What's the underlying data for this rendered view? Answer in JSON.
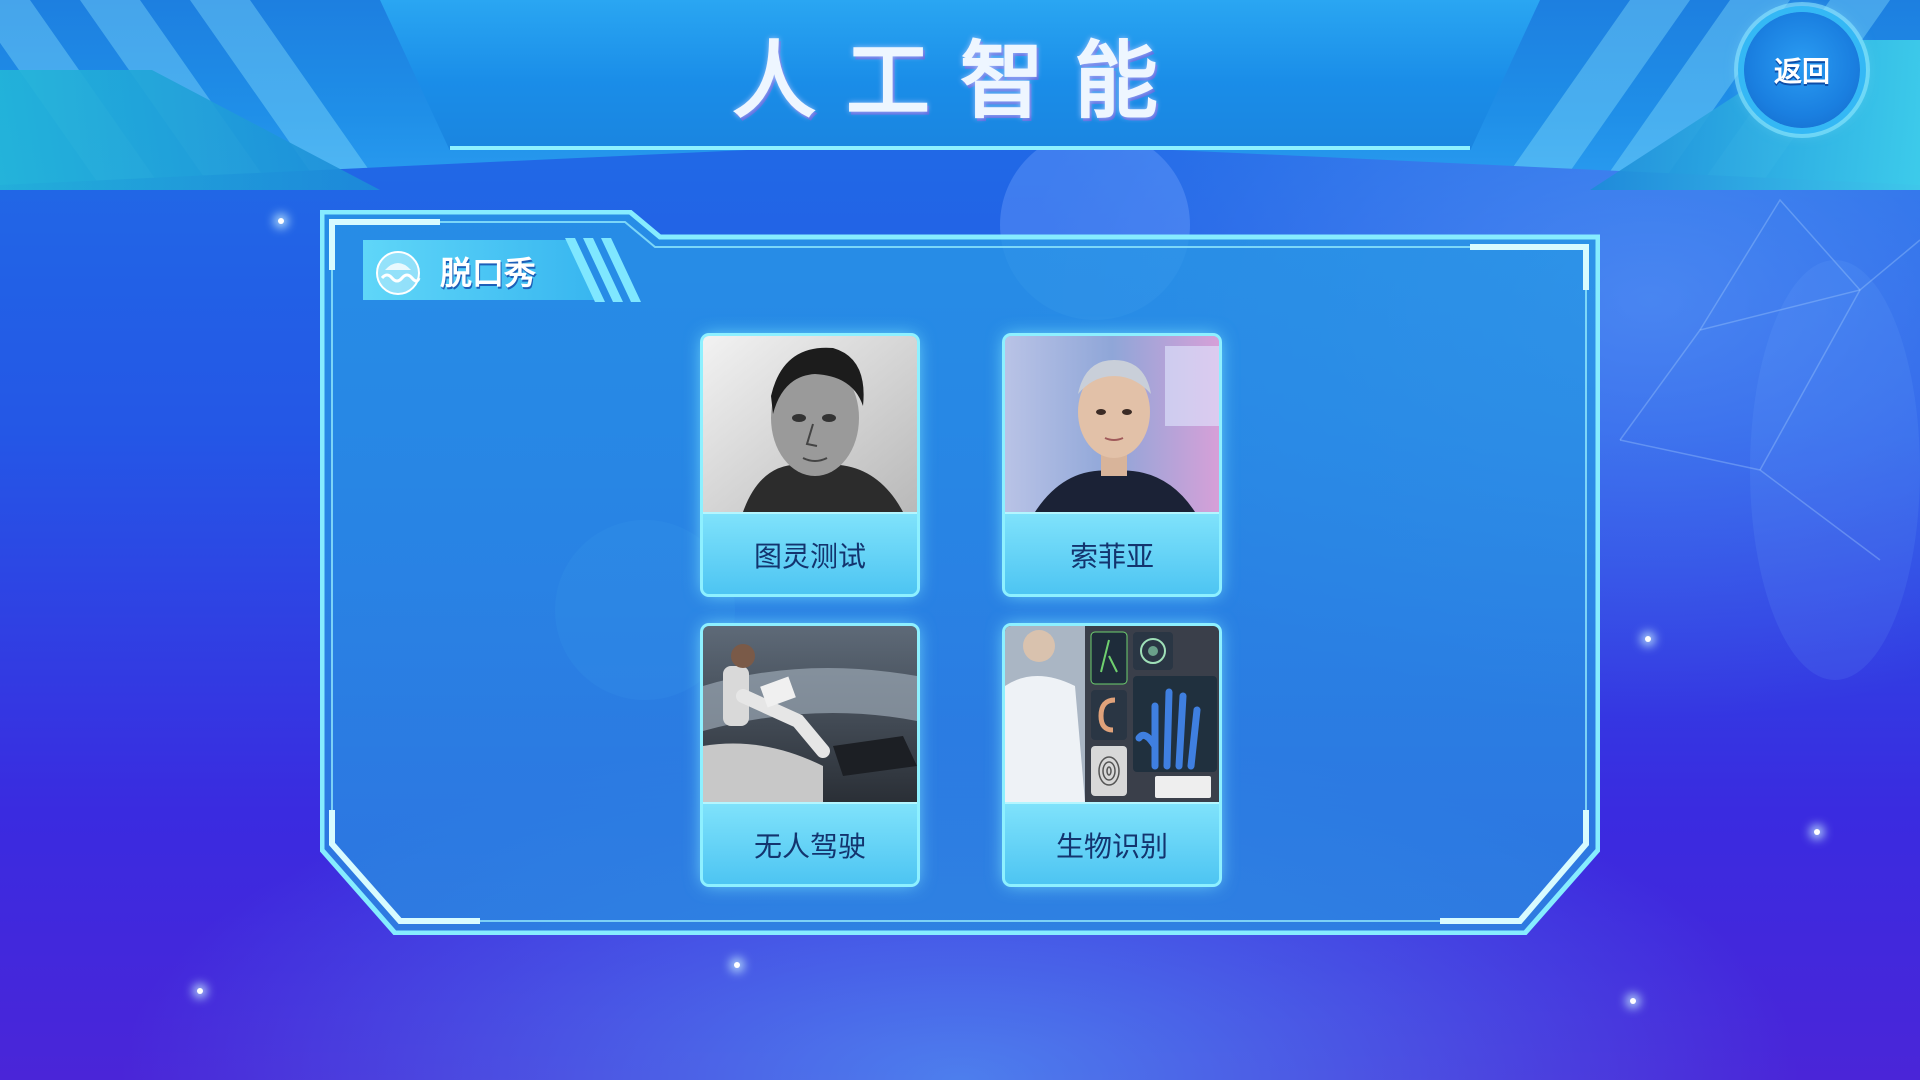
{
  "header": {
    "title": "人工智能",
    "back_label": "返回"
  },
  "panel": {
    "tab_label": "脱口秀"
  },
  "cards": [
    {
      "label": "图灵测试",
      "image": "alan-turing-portrait"
    },
    {
      "label": "索菲亚",
      "image": "sophia-robot"
    },
    {
      "label": "无人驾驶",
      "image": "self-driving-car-interior"
    },
    {
      "label": "生物识别",
      "image": "biometrics-collage"
    }
  ],
  "colors": {
    "accent": "#8ef0ff",
    "caption_text": "#13346e",
    "background_top": "#1f72e6",
    "background_bottom": "#4a25d8"
  }
}
